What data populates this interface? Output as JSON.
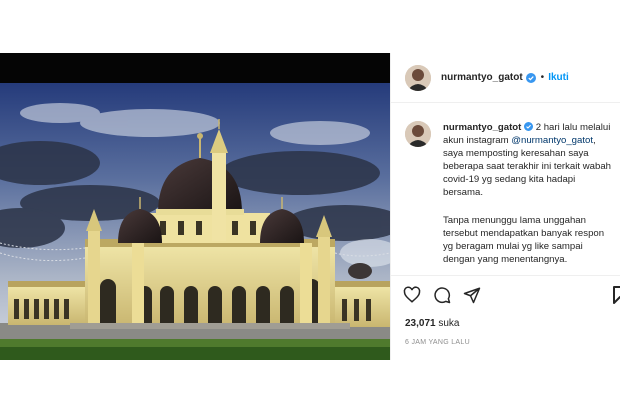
{
  "header": {
    "username": "nurmantyo_gatot",
    "separator": "•",
    "follow_label": "Ikuti"
  },
  "caption": {
    "username": "nurmantyo_gatot",
    "paragraph1_before": "2 hari lalu melalui akun instagram ",
    "mention": "@nurmantyo_gatot",
    "paragraph1_after": ", saya memposting keresahan saya beberapa saat terakhir ini terkait wabah covid-19 yg sedang kita hadapi bersama.",
    "paragraph2": "Tanpa menunggu lama unggahan tersebut mendapatkan banyak respon yg beragam mulai yg like sampai dengan yang menentangnya."
  },
  "actions": {
    "like_icon": "heart-icon",
    "comment_icon": "comment-icon",
    "share_icon": "share-icon",
    "save_icon": "bookmark-icon",
    "likes_count": "23,071",
    "likes_label": "suka",
    "timestamp": "6 JAM YANG LALU"
  },
  "colors": {
    "link": "#0095f6",
    "mention": "#00376b",
    "verified": "#3897f0",
    "muted": "#8e8e8e"
  },
  "photo": {
    "subject": "mosque-photo"
  }
}
